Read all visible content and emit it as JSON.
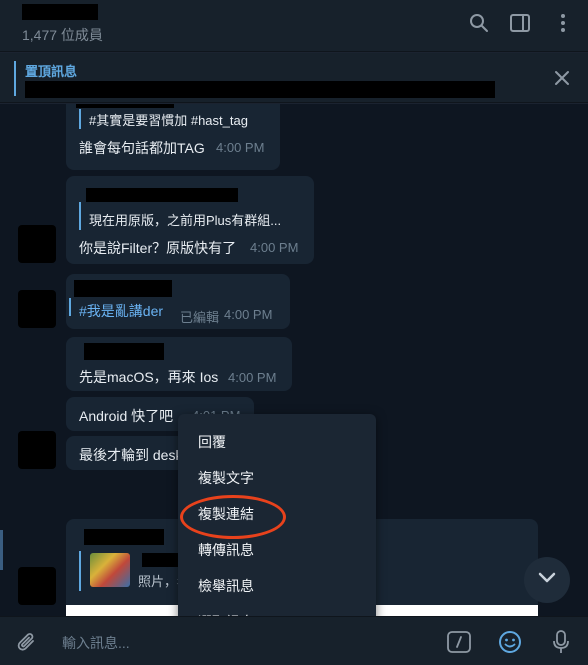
{
  "header": {
    "member_count": "1,477 位成員",
    "icons": [
      "search-icon",
      "sidebar-toggle-icon",
      "more-vertical-icon"
    ]
  },
  "pinned": {
    "title": "置頂訊息"
  },
  "messages": [
    {
      "quote": "#其實是要習慣加 #hast_tag",
      "text": "誰會每句話都加TAG",
      "time": "4:00 PM"
    },
    {
      "quote": "現在用原版，之前用Plus有群組...",
      "text": "你是說Filter？原版快有了",
      "time": "4:00 PM"
    },
    {
      "text": "#我是亂講der",
      "edited": "已編輯",
      "time": "4:00 PM"
    },
    {
      "text": "先是macOS，再來 Ios",
      "time": "4:00 PM"
    },
    {
      "text": "Android 快了吧",
      "time": "4:01 PM"
    },
    {
      "text": "最後才輪到 desk"
    },
    {
      "quote": "照片，看"
    }
  ],
  "context_menu": {
    "items": [
      "回覆",
      "複製文字",
      "複製連結",
      "轉傳訊息",
      "檢舉訊息",
      "選取訊息"
    ],
    "highlighted": "複製連結"
  },
  "input": {
    "placeholder": "輸入訊息..."
  },
  "colors": {
    "accent": "#5fa8e0",
    "highlight_ring": "#e8421c",
    "chat_bg": "#0e1621",
    "bubble_bg": "#182533"
  }
}
